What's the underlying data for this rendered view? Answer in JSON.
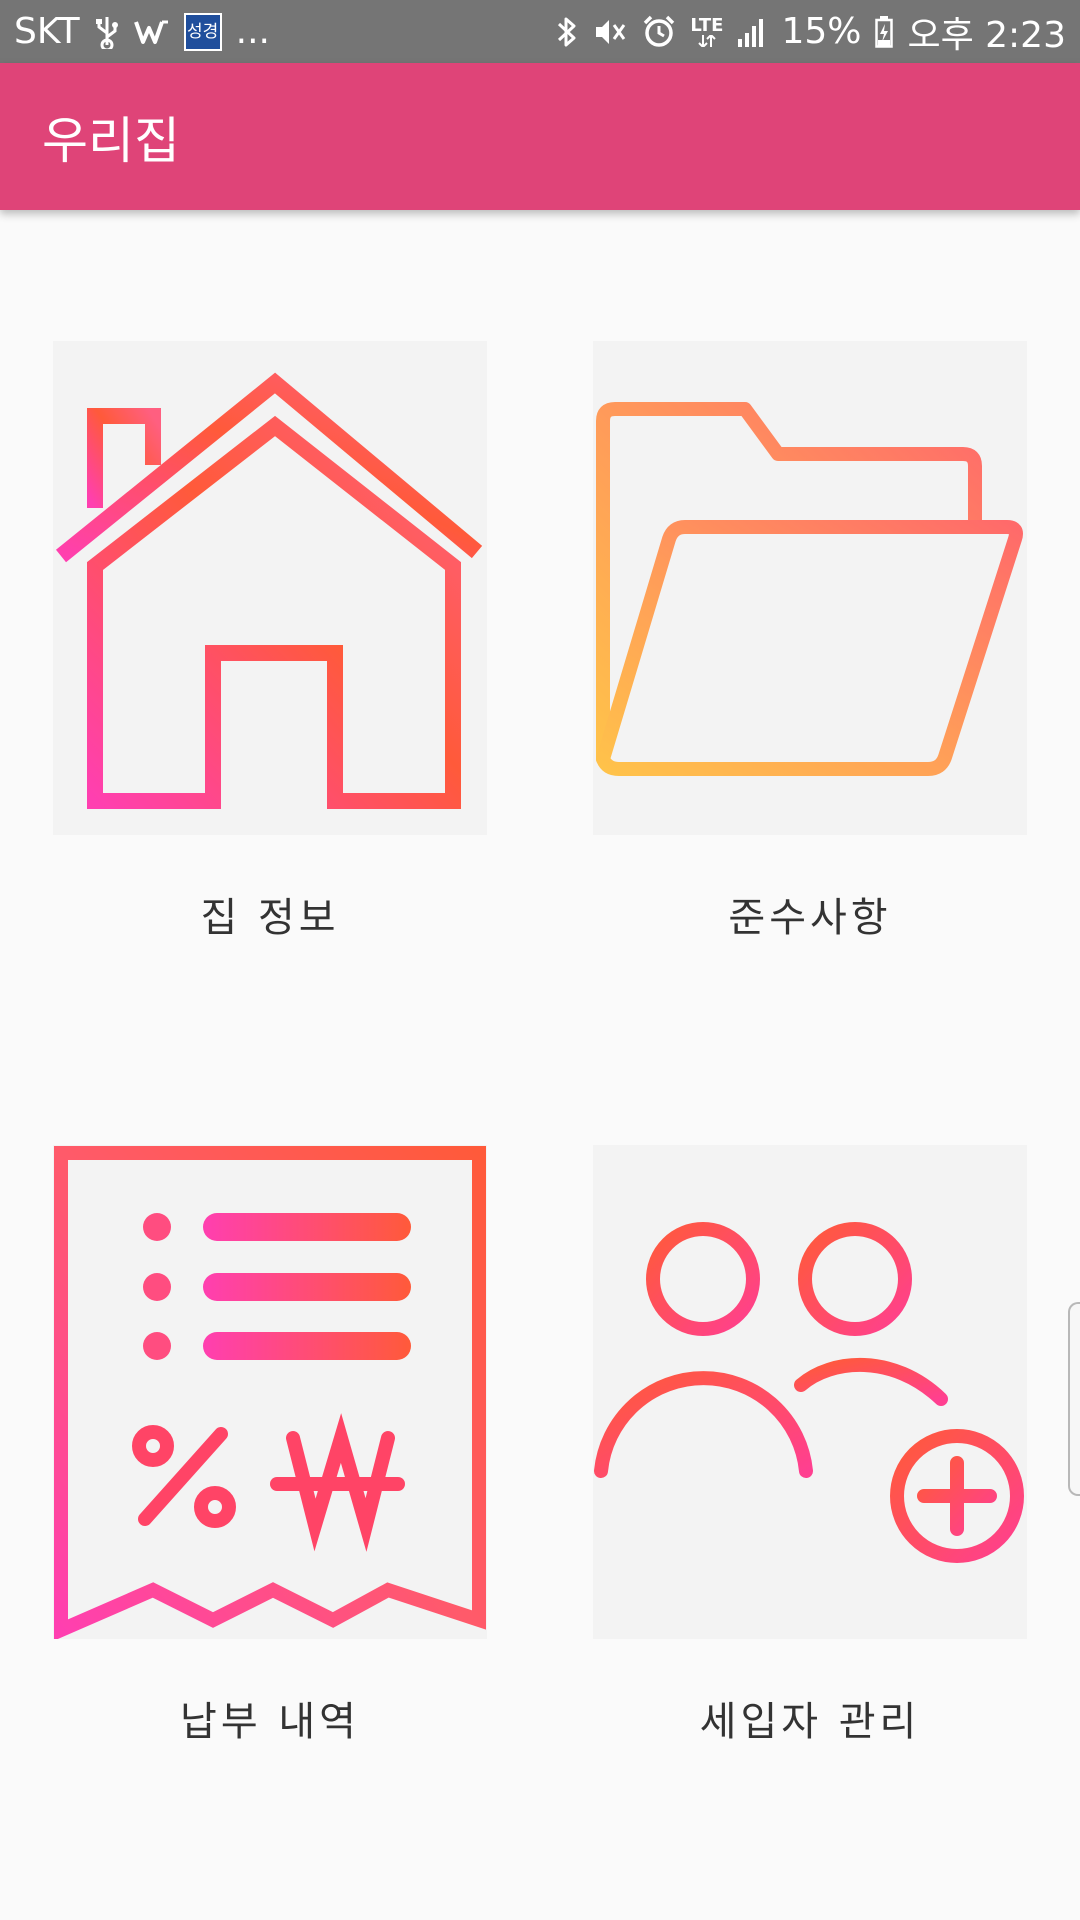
{
  "status_bar": {
    "carrier": "SKT",
    "news_app_icon_text": "성경",
    "more_indicator": "...",
    "battery_percent": "15%",
    "time": "오후 2:23",
    "network_type": "LTE",
    "icons": [
      "usb-icon",
      "w-app-icon",
      "news-app-icon",
      "bluetooth-icon",
      "mute-vibrate-icon",
      "alarm-icon",
      "lte-icon",
      "signal-icon",
      "battery-charging-icon"
    ]
  },
  "app_bar": {
    "title": "우리집",
    "color": "#df4478"
  },
  "menu": {
    "house_info": {
      "label": "집 정보",
      "icon": "house-icon"
    },
    "compliance": {
      "label": "준수사항",
      "icon": "folder-icon"
    },
    "payment_history": {
      "label": "납부 내역",
      "icon": "receipt-icon"
    },
    "tenant_management": {
      "label": "세입자 관리",
      "icon": "add-users-icon"
    }
  },
  "colors": {
    "icon_gradient_pink": "#ff3fb0",
    "icon_gradient_orange": "#ff5a3a",
    "icon_gradient_yellow": "#ffc24a",
    "tile_background": "#f3f3f3"
  }
}
